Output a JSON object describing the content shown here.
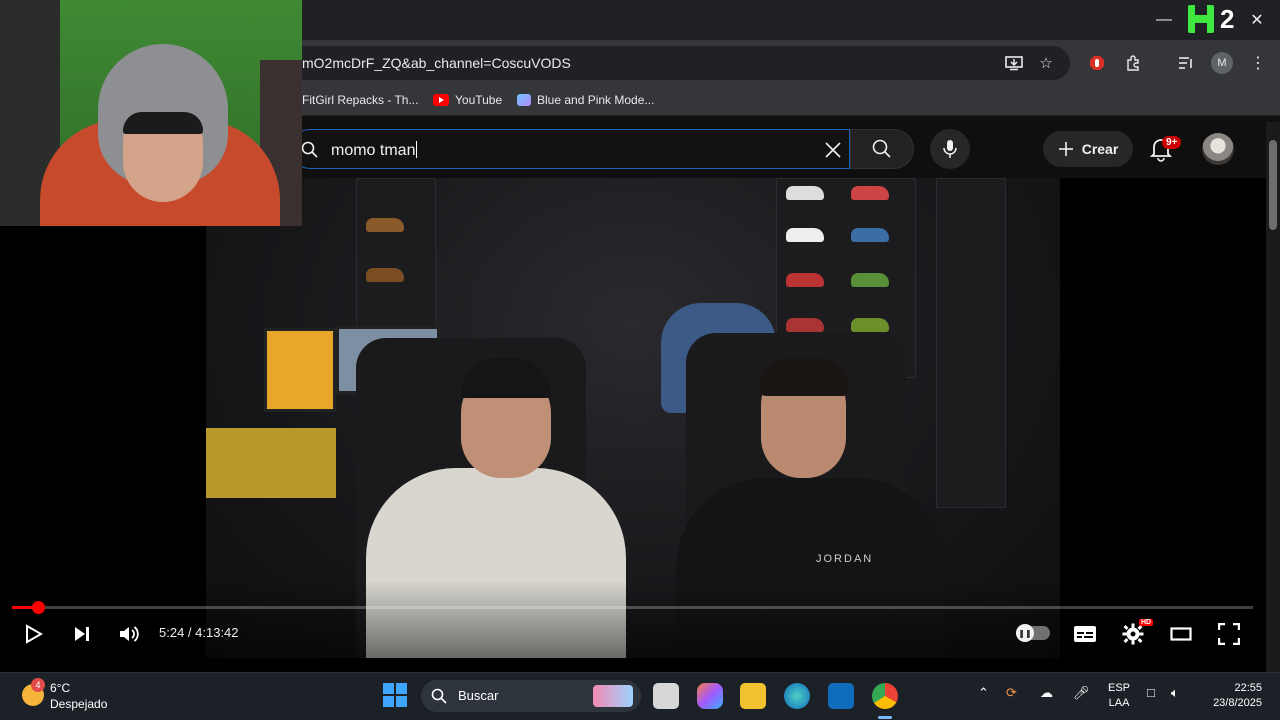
{
  "browser": {
    "url": "mO2mcDrF_ZQ&ab_channel=CoscuVODS",
    "overlay_counter": "2",
    "bookmarks": [
      {
        "label": "FitGirl Repacks - Th..."
      },
      {
        "label": "YouTube"
      },
      {
        "label": "Blue and Pink Mode..."
      }
    ],
    "profile_initial": "M"
  },
  "youtube": {
    "search_value": "momo tman",
    "create_label": "Crear",
    "notifications_badge": "9+"
  },
  "player": {
    "time_display": "5:24 / 4:13:42",
    "progress_fraction": 0.021,
    "jersey_text": "JORDAN",
    "quality_badge": "HD"
  },
  "taskbar": {
    "weather_badge": "4",
    "temperature": "6°C",
    "condition": "Despejado",
    "search_label": "Buscar",
    "lang_line1": "ESP",
    "lang_line2": "LAA",
    "time": "22:55",
    "date": "23/8/2025"
  }
}
